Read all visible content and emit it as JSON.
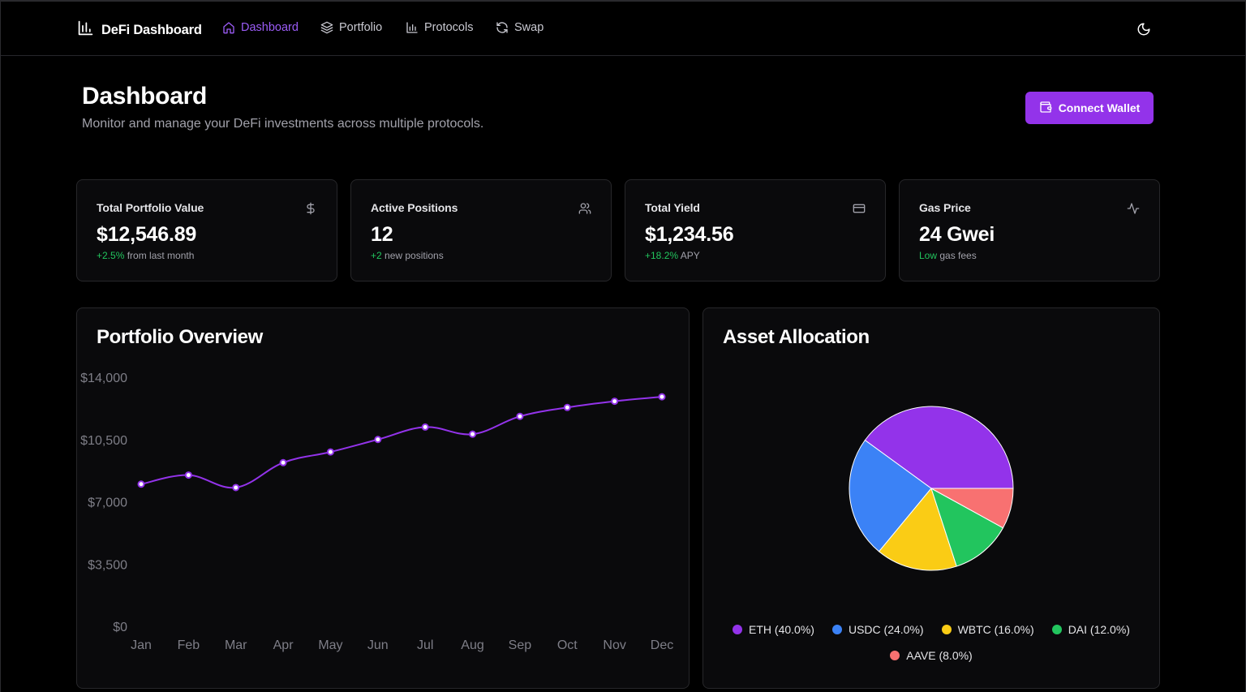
{
  "nav": {
    "brand": "DeFi Dashboard",
    "links": [
      {
        "label": "Dashboard",
        "icon": "home-icon",
        "active": true
      },
      {
        "label": "Portfolio",
        "icon": "layers-icon",
        "active": false
      },
      {
        "label": "Protocols",
        "icon": "bar-chart-icon",
        "active": false
      },
      {
        "label": "Swap",
        "icon": "refresh-icon",
        "active": false
      }
    ],
    "theme_icon": "moon-icon"
  },
  "header": {
    "title": "Dashboard",
    "subtitle": "Monitor and manage your DeFi investments across multiple protocols.",
    "connect_label": "Connect Wallet"
  },
  "stats": [
    {
      "label": "Total Portfolio Value",
      "value": "$12,546.89",
      "highlight": "+2.5%",
      "note": " from last month",
      "icon": "dollar-icon"
    },
    {
      "label": "Active Positions",
      "value": "12",
      "highlight": "+2",
      "note": " new positions",
      "icon": "users-icon"
    },
    {
      "label": "Total Yield",
      "value": "$1,234.56",
      "highlight": "+18.2%",
      "note": " APY",
      "icon": "credit-card-icon"
    },
    {
      "label": "Gas Price",
      "value": "24 Gwei",
      "highlight": "Low",
      "note": " gas fees",
      "icon": "activity-icon"
    }
  ],
  "colors": {
    "accent": "#9333ea",
    "line": "#9333ea",
    "positive": "#22c55e"
  },
  "portfolio": {
    "title": "Portfolio Overview"
  },
  "allocation": {
    "title": "Asset Allocation"
  },
  "chart_data": [
    {
      "type": "line",
      "title": "Portfolio Overview",
      "categories": [
        "Jan",
        "Feb",
        "Mar",
        "Apr",
        "May",
        "Jun",
        "Jul",
        "Aug",
        "Sep",
        "Oct",
        "Nov",
        "Dec"
      ],
      "values": [
        7990,
        8500,
        7800,
        9200,
        9800,
        10500,
        11200,
        10800,
        11800,
        12300,
        12650,
        12900
      ],
      "ylim": [
        0,
        14000
      ],
      "yticks": [
        "$0",
        "$3,500",
        "$7,000",
        "$10,500",
        "$14,000"
      ],
      "ytick_values": [
        0,
        3500,
        7000,
        10500,
        14000
      ],
      "grid": false,
      "color": "#9333ea"
    },
    {
      "type": "pie",
      "title": "Asset Allocation",
      "slices": [
        {
          "label": "ETH",
          "value": 40.0,
          "legend": "ETH (40.0%)",
          "color": "#9333ea"
        },
        {
          "label": "USDC",
          "value": 24.0,
          "legend": "USDC (24.0%)",
          "color": "#3b82f6"
        },
        {
          "label": "WBTC",
          "value": 16.0,
          "legend": "WBTC (16.0%)",
          "color": "#facc15"
        },
        {
          "label": "DAI",
          "value": 12.0,
          "legend": "DAI (12.0%)",
          "color": "#22c55e"
        },
        {
          "label": "AAVE",
          "value": 8.0,
          "legend": "AAVE (8.0%)",
          "color": "#f87171"
        }
      ],
      "legend_position": "bottom"
    }
  ]
}
